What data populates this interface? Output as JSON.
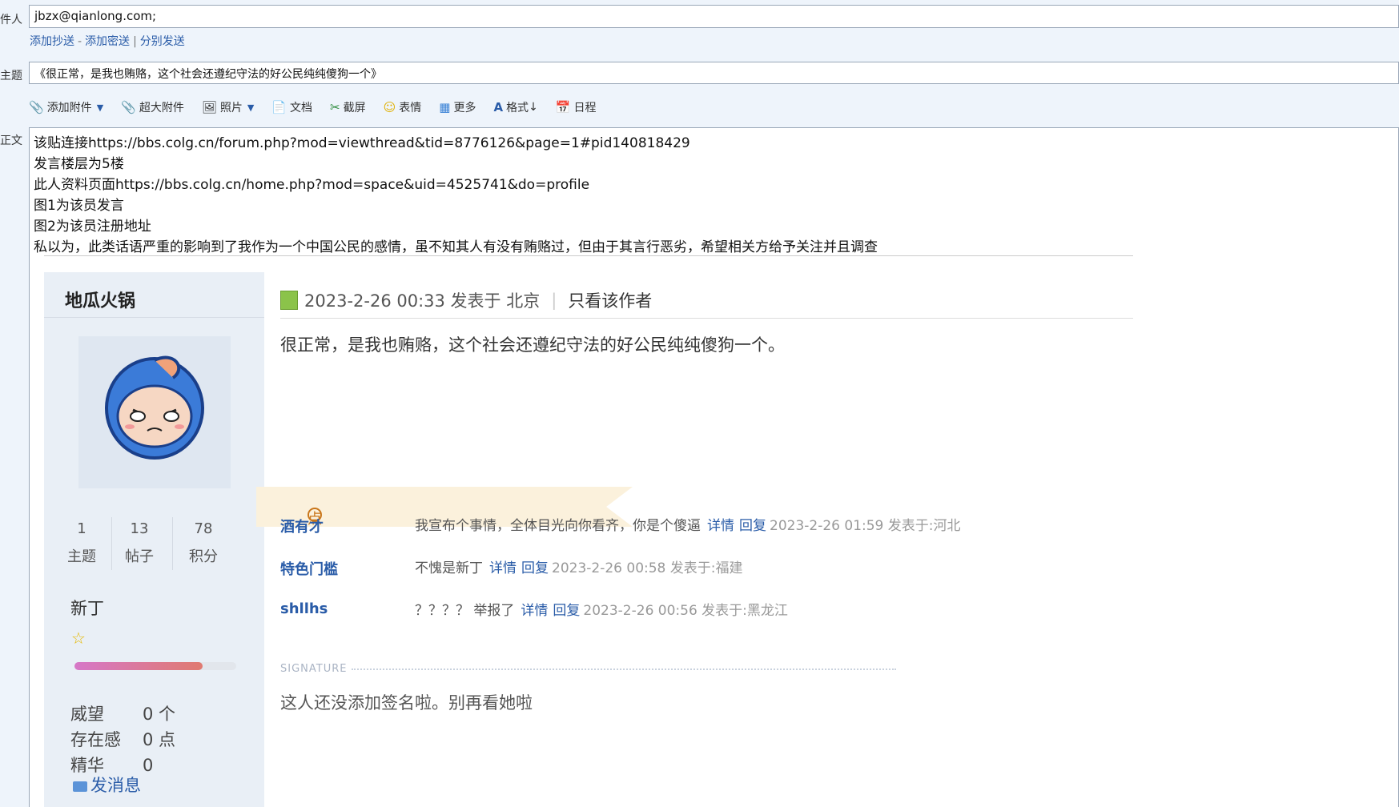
{
  "form": {
    "to_label": "件人",
    "to_value": "jbzx@qianlong.com;",
    "cc_links": [
      "添加抄送",
      "添加密送",
      "分别发送"
    ],
    "cc_sep1": "-",
    "cc_sep2": "|",
    "subject_label": "主题",
    "subject_value": "《很正常，是我也贿赂，这个社会还遵纪守法的好公民纯纯傻狗一个》",
    "body_label": "正文"
  },
  "toolbar": {
    "attach": "添加附件",
    "big_attach": "超大附件",
    "photo": "照片",
    "doc": "文档",
    "screenshot": "截屏",
    "emoji": "表情",
    "more": "更多",
    "format": "格式",
    "schedule": "日程"
  },
  "body_lines": [
    "该贴连接https://bbs.colg.cn/forum.php?mod=viewthread&tid=8776126&page=1#pid140818429",
    "发言楼层为5楼",
    "此人资料页面https://bbs.colg.cn/home.php?mod=space&uid=4525741&do=profile",
    "图1为该员发言",
    "图2为该员注册地址",
    "私以为，此类话语严重的影响到了我作为一个中国公民的感情，虽不知其人有没有贿赂过，但由于其言行恶劣，希望相关方给予关注并且调查"
  ],
  "post": {
    "username": "地瓜火锅",
    "stats": [
      {
        "num": "1",
        "label": "主题"
      },
      {
        "num": "13",
        "label": "帖子"
      },
      {
        "num": "78",
        "label": "积分"
      }
    ],
    "rank": "新丁",
    "rank_progress": 0.79,
    "attrs": [
      {
        "k": "威望",
        "v": "0 个"
      },
      {
        "k": "存在感",
        "v": "0 点"
      },
      {
        "k": "精华",
        "v": "0"
      }
    ],
    "send_msg": "发消息",
    "time_location": "2023-2-26 00:33 发表于 北京",
    "only_author": "只看该作者",
    "content": "很正常，是我也贿赂，这个社会还遵纪守法的好公民纯纯傻狗一个。",
    "review_label": "点评",
    "comments": [
      {
        "user": "酒有才",
        "text": "我宣布个事情，全体目光向你看齐，你是个傻逼",
        "detail": "详情",
        "reply": "回复",
        "meta": "2023-2-26 01:59 发表于:河北"
      },
      {
        "user": "特色门槛",
        "text": "不愧是新丁",
        "detail": "详情",
        "reply": "回复",
        "meta": "2023-2-26 00:58 发表于:福建"
      },
      {
        "user": "shllhs",
        "text": "？？？？ 举报了",
        "detail": "详情",
        "reply": "回复",
        "meta": "2023-2-26 00:56 发表于:黑龙江"
      }
    ],
    "signature_label": "SIGNATURE",
    "signature": "这人还没添加签名啦。别再看她啦"
  }
}
